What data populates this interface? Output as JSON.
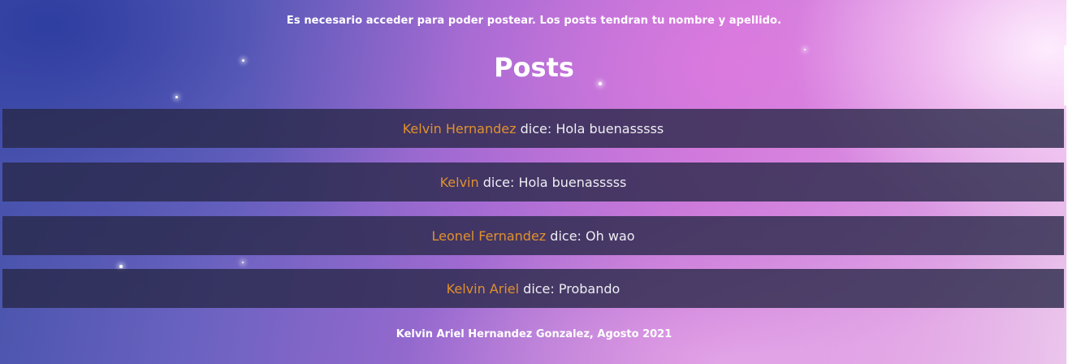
{
  "notice": "Es necesario acceder para poder postear. Los posts tendran tu nombre y apellido.",
  "title": "Posts",
  "posts": [
    {
      "author": "Kelvin Hernandez",
      "verb": "dice:",
      "message": "Hola buenasssss"
    },
    {
      "author": "Kelvin",
      "verb": "dice:",
      "message": "Hola buenasssss"
    },
    {
      "author": "Leonel Fernandez",
      "verb": "dice:",
      "message": "Oh wao"
    },
    {
      "author": "Kelvin Ariel",
      "verb": "dice:",
      "message": "Probando"
    }
  ],
  "footer": "Kelvin Ariel Hernandez Gonzalez, Agosto 2021",
  "colors": {
    "author": "#e0912e",
    "post_background": "#282848",
    "text": "#ffffff"
  }
}
